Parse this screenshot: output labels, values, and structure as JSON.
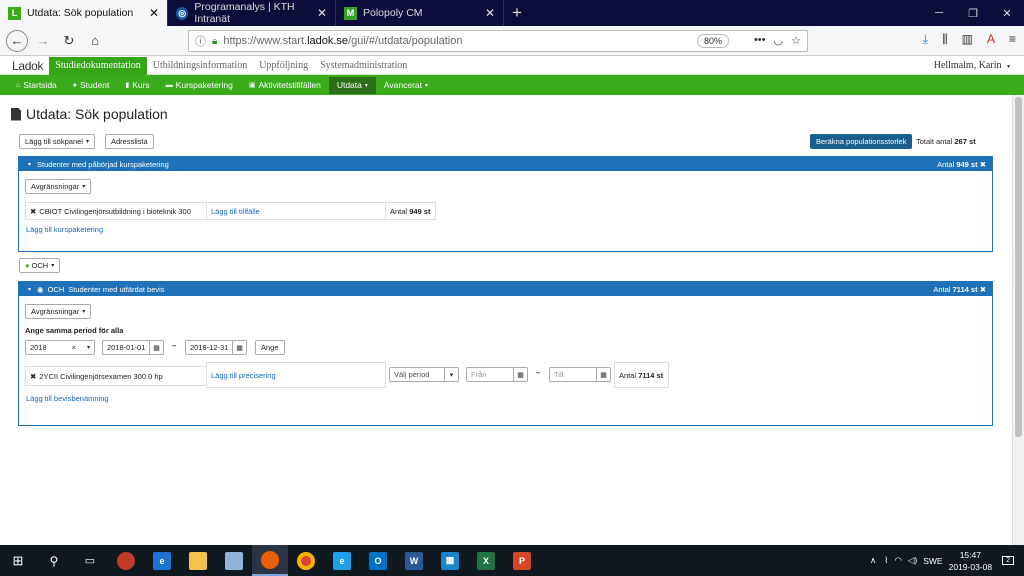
{
  "browser": {
    "tabs": [
      {
        "title": "Utdata: Sök population",
        "active": true,
        "favicon": "L",
        "color": "#3aab1b"
      },
      {
        "title": "Programanalys | KTH Intranät",
        "active": false,
        "favicon": "K",
        "color": "#1954a6"
      },
      {
        "title": "Polopoly CM",
        "active": false,
        "favicon": "M",
        "color": "#35a02b"
      }
    ],
    "url_prefix": "https://www.start.",
    "url_domain": "ladok.se",
    "url_suffix": "/gui/#/utdata/population",
    "zoom": "80%"
  },
  "app": {
    "logo": "Ladok",
    "modules": [
      "Studiedokumentation",
      "Utbildningsinformation",
      "Uppföljning",
      "Systemadministration"
    ],
    "user": "Hellmalm, Karin",
    "menu": [
      {
        "label": "Startsida",
        "icon": "home-icon"
      },
      {
        "label": "Student",
        "icon": "user-icon"
      },
      {
        "label": "Kurs",
        "icon": "book-icon"
      },
      {
        "label": "Kurspaketering",
        "icon": "folder-icon"
      },
      {
        "label": "Aktivitetstillfällen",
        "icon": "calendar-icon"
      },
      {
        "label": "Utdata",
        "icon": "",
        "dropdown": true,
        "active": true
      },
      {
        "label": "Avancerat",
        "icon": "",
        "dropdown": true
      }
    ]
  },
  "page": {
    "title": "Utdata: Sök population",
    "add_panel_label": "Lägg till sökpanel",
    "address_list_label": "Adresslista",
    "compute_label": "Beräkna populationsstorlek",
    "total_prefix": "Totalt antal",
    "total_value": "267 st",
    "och_label": "OCH"
  },
  "panel1": {
    "title": "Studenter med påbörjad kurspaketering",
    "count_prefix": "Antal",
    "count_value": "949 st",
    "filter_label": "Avgränsningar",
    "item": "CBIOT Civilingenjörsutbildning i bioteknik 300",
    "add_occasion": "Lägg till tillfälle",
    "item_count_prefix": "Antal",
    "item_count_value": "949 st",
    "add_link": "Lägg till kurspaketering"
  },
  "panel2": {
    "prefix": "OCH",
    "title": "Studenter med utfärdat bevis",
    "count_prefix": "Antal",
    "count_value": "7114 st",
    "filter_label": "Avgränsningar",
    "period_heading": "Ange samma period för alla",
    "year": "2018",
    "date_from": "2018-01-01",
    "date_to": "2018-12-31",
    "apply_label": "Ange",
    "item": "2YCII Civilingenjörsexamen 300.0 hp",
    "add_spec": "Lägg till precisering",
    "period_select": "Välj period",
    "from_ph": "Från",
    "to_ph": "Till",
    "item_count_prefix": "Antal",
    "item_count_value": "7114 st",
    "add_link": "Lägg till bevisbenämning"
  },
  "taskbar": {
    "lang": "SWE",
    "time": "15:47",
    "date": "2019-03-08",
    "notif": "2"
  }
}
